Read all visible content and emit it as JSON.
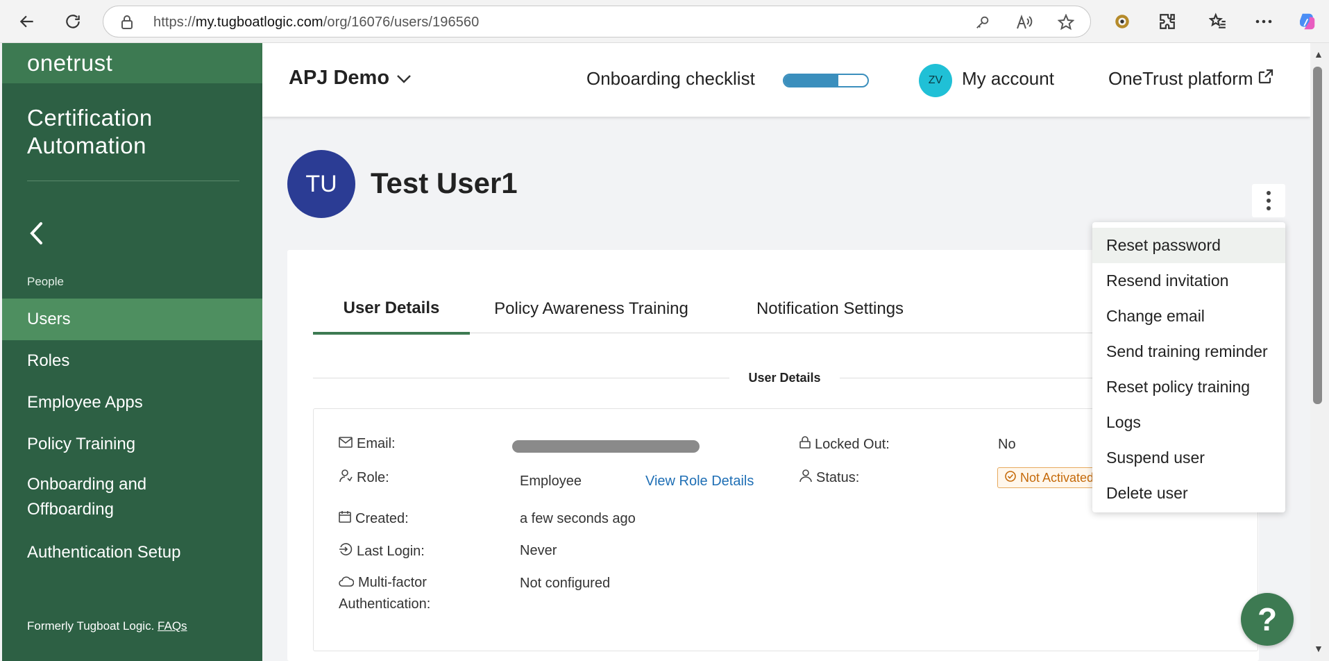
{
  "browser": {
    "url_prefix": "https://",
    "url_host": "my.tugboatlogic.com",
    "url_path": "/org/16076/users/196560"
  },
  "sidebar": {
    "brand": "onetrust",
    "product_line1": "Certification",
    "product_line2": "Automation",
    "section_label": "People",
    "items": [
      {
        "label": "Users",
        "active": true
      },
      {
        "label": "Roles"
      },
      {
        "label": "Employee Apps"
      },
      {
        "label": "Policy Training"
      },
      {
        "label": "Onboarding and Offboarding"
      },
      {
        "label": "Authentication Setup"
      }
    ],
    "footer_text": "Formerly Tugboat Logic.",
    "footer_link": "FAQs"
  },
  "header": {
    "org_name": "APJ Demo",
    "checklist_label": "Onboarding checklist",
    "checklist_progress_percent": 65,
    "avatar_initials": "ZV",
    "my_account": "My account",
    "platform_link": "OneTrust platform"
  },
  "user": {
    "initials": "TU",
    "name": "Test User1"
  },
  "tabs": [
    {
      "label": "User Details",
      "active": true
    },
    {
      "label": "Policy Awareness Training"
    },
    {
      "label": "Notification Settings"
    }
  ],
  "details": {
    "section_title": "User Details",
    "email_label": "Email:",
    "role_label": "Role:",
    "role_value": "Employee",
    "view_role_link": "View Role Details",
    "created_label": "Created:",
    "created_value": "a few seconds ago",
    "last_login_label": "Last Login:",
    "last_login_value": "Never",
    "mfa_label_line1": "Multi-factor",
    "mfa_label_line2": "Authentication:",
    "mfa_value": "Not configured",
    "locked_label": "Locked Out:",
    "locked_value": "No",
    "status_label": "Status:",
    "status_value": "Not Activated"
  },
  "menu": {
    "items": [
      "Reset password",
      "Resend invitation",
      "Change email",
      "Send training reminder",
      "Reset policy training",
      "Logs",
      "Suspend user",
      "Delete user"
    ]
  },
  "help_label": "?"
}
